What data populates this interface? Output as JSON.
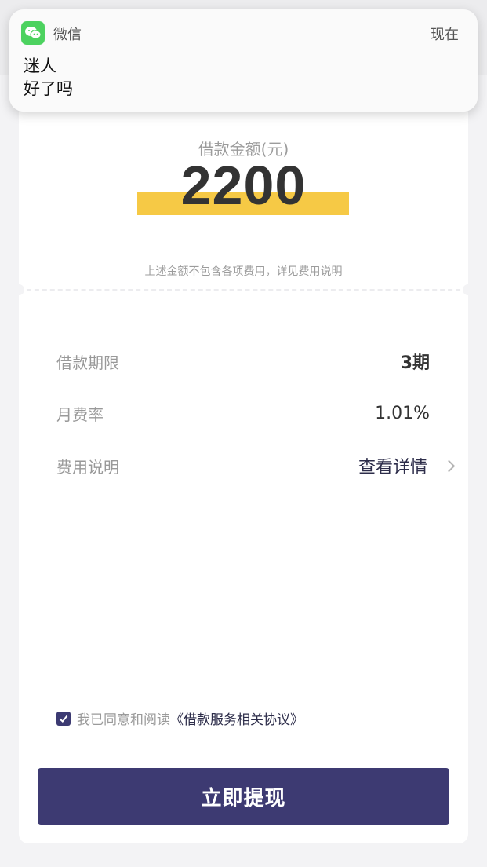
{
  "notification": {
    "app": "微信",
    "time": "现在",
    "title": "迷人",
    "body": "好了吗"
  },
  "loan": {
    "amount_label": "借款金额(元)",
    "amount": "2200",
    "amount_note": "上述金额不包含各项费用，详见费用说明"
  },
  "details": [
    {
      "label": "借款期限",
      "value": "3期"
    },
    {
      "label": "月费率",
      "value": "1.01%"
    },
    {
      "label": "费用说明",
      "value": "查看详情"
    }
  ],
  "agreement": {
    "checked": true,
    "prefix": "我已同意和阅读",
    "link": "《借款服务相关协议》"
  },
  "cta_label": "立即提现",
  "colors": {
    "accent": "#3d3a72",
    "highlight": "#f6c945",
    "wechat_green": "#4cd25f"
  },
  "icons": [
    "wechat-icon",
    "chevron-right-icon",
    "checkbox-checked-icon"
  ]
}
